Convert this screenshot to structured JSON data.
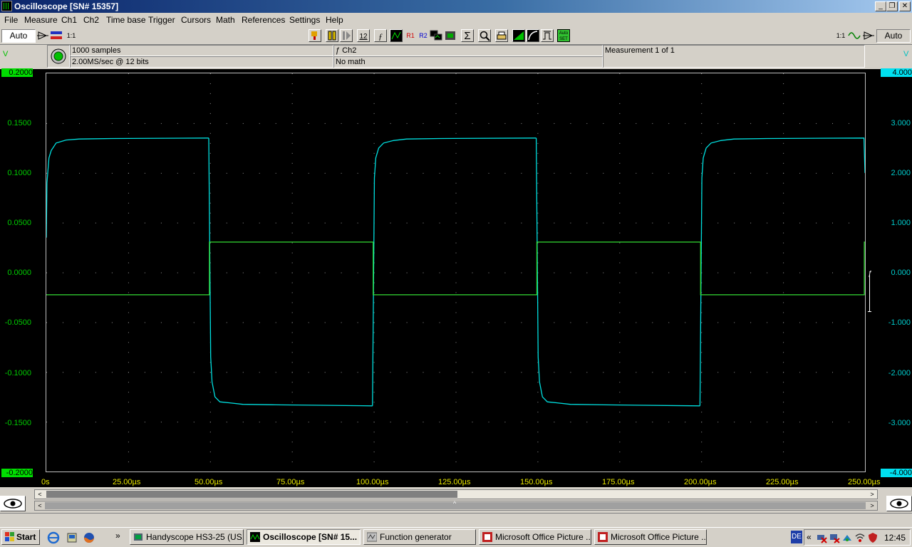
{
  "window": {
    "title": "Oscilloscope  [SN# 15357]",
    "controls": [
      "_",
      "❐",
      "✕"
    ]
  },
  "menu": [
    "File",
    "Measure",
    "Ch1",
    "Ch2",
    "Time base",
    "Trigger",
    "Cursors",
    "Math",
    "References",
    "Settings",
    "Help"
  ],
  "toolbar": {
    "left_auto": "Auto",
    "right_auto": "Auto",
    "btn_12": "12",
    "btn_r1": "R1",
    "btn_r2": "R2",
    "btn_sigma": "Σ",
    "btn_autoset": "Auto SET",
    "ratio_left": "1:1",
    "ratio_right": "1:1"
  },
  "info": {
    "samples": "1000 samples",
    "rate": "2.00MS/sec @ 12 bits",
    "math_channel": "ƒ Ch2",
    "math": "No math",
    "measurement": "Measurement 1 of 1"
  },
  "axes": {
    "left_unit": "V",
    "right_unit": "V",
    "left_ticks": [
      "0.2000",
      "0.1500",
      "0.1000",
      "0.0500",
      "0.0000",
      "-0.0500",
      "-0.1000",
      "-0.1500",
      "-0.2000"
    ],
    "right_ticks": [
      "4.000",
      "3.000",
      "2.000",
      "1.000",
      "0.000",
      "-1.000",
      "-2.000",
      "-3.000",
      "-4.000"
    ],
    "x_ticks": [
      "0s",
      "25.00µs",
      "50.00µs",
      "75.00µs",
      "100.00µs",
      "125.00µs",
      "150.00µs",
      "175.00µs",
      "200.00µs",
      "225.00µs",
      "250.00µs"
    ]
  },
  "chart_data": {
    "type": "line",
    "x_range": [
      0,
      250
    ],
    "x_unit": "µs",
    "grid": true,
    "series": [
      {
        "color": "#00e0e0",
        "axis": "right",
        "ylim": [
          -4,
          4
        ],
        "segments": [
          {
            "x": [
              0,
              0.2,
              0.8,
              1.5,
              3,
              6,
              10,
              20,
              49.6
            ],
            "y": [
              0.7,
              1.8,
              2.3,
              2.45,
              2.6,
              2.66,
              2.68,
              2.69,
              2.7
            ]
          },
          {
            "x": [
              49.6,
              50.2,
              50.6,
              51.5,
              53,
              56,
              60,
              70,
              99.6
            ],
            "y": [
              2.7,
              -1.7,
              -2.2,
              -2.5,
              -2.6,
              -2.62,
              -2.65,
              -2.66,
              -2.68
            ]
          },
          {
            "x": [
              99.6,
              100.2,
              100.6,
              101.5,
              103,
              106,
              110,
              120,
              149.6
            ],
            "y": [
              -2.68,
              1.9,
              2.3,
              2.5,
              2.6,
              2.65,
              2.68,
              2.69,
              2.7
            ]
          },
          {
            "x": [
              149.6,
              150.2,
              150.6,
              151.5,
              153,
              156,
              160,
              170,
              199.6
            ],
            "y": [
              2.7,
              -1.7,
              -2.2,
              -2.5,
              -2.6,
              -2.62,
              -2.65,
              -2.66,
              -2.68
            ]
          },
          {
            "x": [
              199.6,
              200.2,
              200.6,
              201.5,
              203,
              206,
              210,
              220,
              249.7,
              250
            ],
            "y": [
              -2.68,
              1.9,
              2.3,
              2.5,
              2.6,
              2.65,
              2.68,
              2.69,
              2.7,
              2.0
            ]
          }
        ]
      },
      {
        "color": "#33dd33",
        "axis": "left",
        "ylim": [
          -0.2,
          0.2
        ],
        "segments": [
          {
            "x": [
              0,
              49.8,
              49.8,
              99.8,
              99.8,
              149.8,
              149.8,
              199.8,
              199.8,
              249.8,
              249.8,
              250
            ],
            "y": [
              -0.0225,
              -0.0225,
              0.0305,
              0.0305,
              -0.0225,
              -0.0225,
              0.0305,
              0.0305,
              -0.0225,
              -0.0225,
              0.0305,
              0.0305
            ]
          }
        ]
      }
    ]
  },
  "trigger_marker": "ƒ",
  "scroll": {
    "left_arrow": "<",
    "right_arrow": ">",
    "up_arrow": "^"
  },
  "taskbar": {
    "start": "Start",
    "chevron": "»",
    "tasks": [
      "Handyscope HS3-25 (US...",
      "Oscilloscope  [SN# 15...",
      "Function generator",
      "Microsoft Office Picture ...",
      "Microsoft Office Picture ..."
    ],
    "lang": "DE",
    "tray_chevron": "«",
    "clock": "12:45"
  }
}
